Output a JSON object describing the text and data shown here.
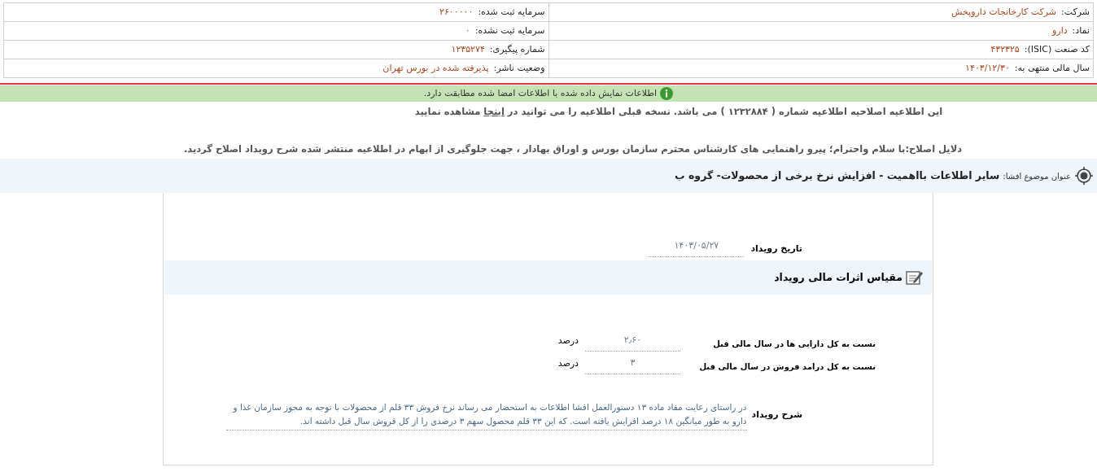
{
  "company_info": {
    "rows": [
      [
        {
          "label": "شرکت:",
          "value": "شرکت کارخانجات داروپخش"
        },
        {
          "label": "سرمایه ثبت شده:",
          "value": "۲۶۰۰۰۰۰"
        }
      ],
      [
        {
          "label": "نماد:",
          "value": "دارو"
        },
        {
          "label": "سرمایه ثبت نشده:",
          "value": "۰"
        }
      ],
      [
        {
          "label": "کد صنعت (ISIC):",
          "value": "۴۳۲۳۲۵"
        },
        {
          "label": "شماره پیگیری:",
          "value": "۱۲۳۵۲۷۴"
        }
      ],
      [
        {
          "label": "سال مالی منتهی به:",
          "value": "۱۴۰۳/۱۲/۳۰"
        },
        {
          "label": "وضعیت ناشر:",
          "value": "پذیرفته شده در بورس تهران"
        }
      ]
    ]
  },
  "verification": {
    "text": "اطلاعات نمایش داده شده با اطلاعات امضا شده مطابقت دارد."
  },
  "correction_notice": {
    "before": "این اطلاعیه اصلاحیه اطلاعیه شماره ( ۱۲۳۲۸۸۴ ) می باشد. نسخه قبلی اطلاعیه را می توانید در",
    "link": "اینجا",
    "after": "مشاهده نمایید"
  },
  "correction_reasons": "دلایل اصلاح:با سلام واحترام؛ پیرو راهنمایی های کارشناس محترم سازمان بورس و اوراق بهادار ، جهت جلوگیری از ابهام در اطلاعیه منتشر شده شرح رویداد اصلاح گردید.",
  "disclosure_subject": {
    "label": "عنوان موضوع افشا:",
    "title": "سایر اطلاعات بااهمیت - افزایش نرخ برخی از محصولات- گروه ب"
  },
  "event_date": {
    "label": "تاریخ رویداد",
    "value": "۱۴۰۳/۰۵/۲۷"
  },
  "financial_section": {
    "title": "مقیاس اثرات مالی رویداد",
    "rows": [
      {
        "label": "نسبت به کل دارایی ها در سال مالی قبل",
        "value": "۲٫۶۰",
        "unit": "درصد"
      },
      {
        "label": "نسبت به کل درامد فروش در سال مالی قبل",
        "value": "۳",
        "unit": "درصد"
      }
    ]
  },
  "description": {
    "label": "شرح رویداد",
    "text": "در راستای رعایت مفاد ماده ۱۳ دستورالعمل افشا اطلاعات به استحضار می رساند نرخ فروش ۳۳ قلم از محصولات با توجه به مجوز سازمان غذا و دارو به طور میانگین ۱۸ درصد افزایش یافته است. که این ۳۳ قلم محصول سهم ۳ درصدی را از کل فروش سال قبل داشته اند."
  }
}
